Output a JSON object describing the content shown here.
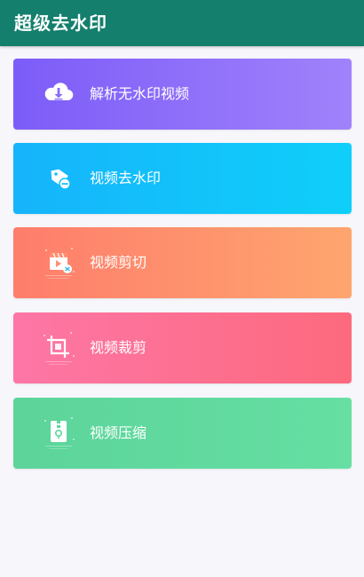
{
  "app_bar": {
    "title": "超级去水印"
  },
  "colors": {
    "app_bar": "#137f6c",
    "background": "#f7f6fb"
  },
  "features": [
    {
      "label": "解析无水印视频",
      "icon": "cloud-download-icon",
      "gradient": [
        "#7c5cf8",
        "#a082fb"
      ]
    },
    {
      "label": "视频去水印",
      "icon": "tag-minus-icon",
      "gradient": [
        "#16b4fb",
        "#0fcffa"
      ]
    },
    {
      "label": "视频剪切",
      "icon": "video-clip-icon",
      "gradient": [
        "#fe7d6c",
        "#fea56e"
      ]
    },
    {
      "label": "视频裁剪",
      "icon": "crop-icon",
      "gradient": [
        "#fd76a6",
        "#fd6a7e"
      ]
    },
    {
      "label": "视频压缩",
      "icon": "file-zip-icon",
      "gradient": [
        "#5cd49a",
        "#66dfa3"
      ]
    }
  ]
}
